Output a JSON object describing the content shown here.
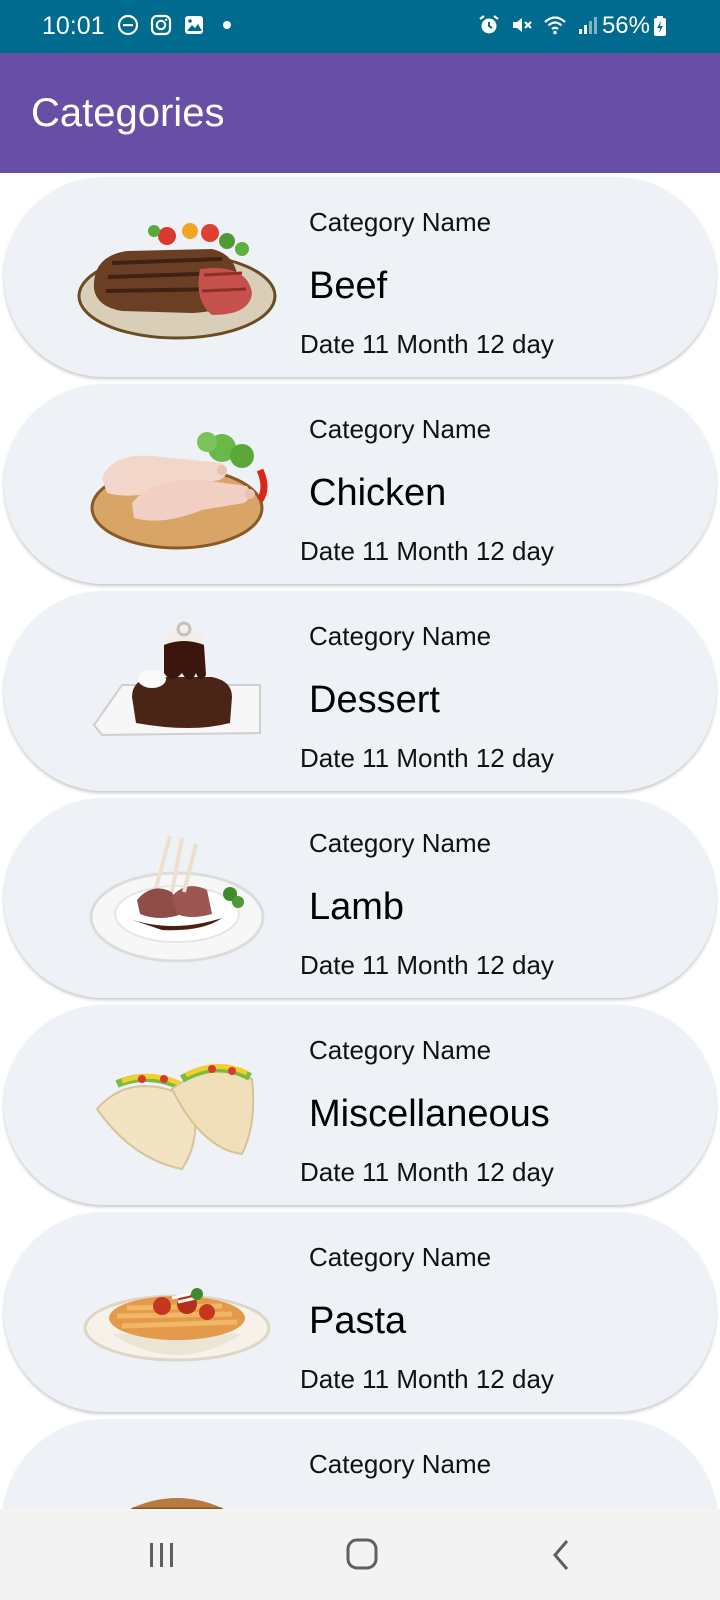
{
  "status_bar": {
    "time": "10:01",
    "battery": "56%",
    "left_icons": [
      "dnd-icon",
      "instagram-icon",
      "gallery-icon",
      "dot-icon"
    ],
    "right_icons": [
      "alarm-icon",
      "mute-icon",
      "wifi-icon",
      "signal-icon",
      "battery-icon"
    ]
  },
  "app_bar": {
    "title": "Categories"
  },
  "colors": {
    "status_bar": "#006b8f",
    "app_bar": "#684ea4",
    "card_bg": "#eef2f6"
  },
  "categories": [
    {
      "label": "Category Name",
      "name": "Beef",
      "date": "Date 11 Month 12 day",
      "image": "beef-steak-icon"
    },
    {
      "label": "Category Name",
      "name": "Chicken",
      "date": "Date 11 Month 12 day",
      "image": "chicken-legs-icon"
    },
    {
      "label": "Category Name",
      "name": "Dessert",
      "date": "Date 11 Month 12 day",
      "image": "chocolate-cake-icon"
    },
    {
      "label": "Category Name",
      "name": "Lamb",
      "date": "Date 11 Month 12 day",
      "image": "lamb-chops-icon"
    },
    {
      "label": "Category Name",
      "name": "Miscellaneous",
      "date": "Date 11 Month 12 day",
      "image": "tacos-icon"
    },
    {
      "label": "Category Name",
      "name": "Pasta",
      "date": "Date 11 Month 12 day",
      "image": "pasta-plate-icon"
    },
    {
      "label": "Category Name",
      "name": "",
      "date": "",
      "image": "pie-icon"
    }
  ],
  "nav_bar": {
    "buttons": [
      "recents-icon",
      "home-icon",
      "back-icon"
    ]
  }
}
